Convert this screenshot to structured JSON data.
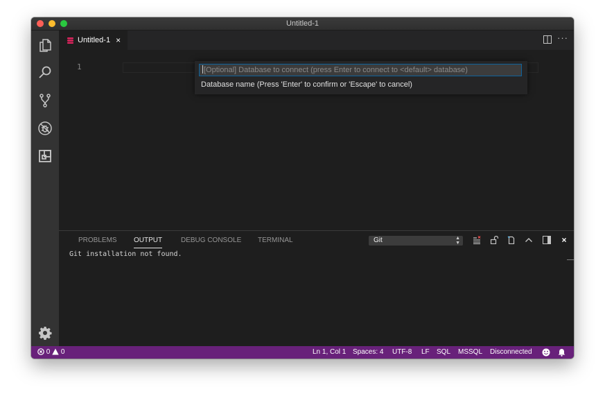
{
  "window": {
    "title": "Untitled-1"
  },
  "tab": {
    "label": "Untitled-1",
    "close_glyph": "×"
  },
  "editor": {
    "line_number": "1"
  },
  "quick_pick": {
    "placeholder": "[Optional] Database to connect (press Enter to connect to <default> database)",
    "message": "Database name (Press 'Enter' to confirm or 'Escape' to cancel)"
  },
  "panel": {
    "tabs": [
      {
        "label": "PROBLEMS"
      },
      {
        "label": "OUTPUT"
      },
      {
        "label": "DEBUG CONSOLE"
      },
      {
        "label": "TERMINAL"
      }
    ],
    "active_tab": "OUTPUT",
    "channel": "Git",
    "output_text": "Git installation not found.",
    "close_glyph": "×"
  },
  "status_bar": {
    "errors": "0",
    "warnings": "0",
    "position": "Ln 1, Col 1",
    "spaces": "Spaces: 4",
    "encoding": "UTF-8",
    "eol": "LF",
    "language": "SQL",
    "provider": "MSSQL",
    "connection": "Disconnected"
  },
  "icons": {
    "activity_bar": [
      "explorer-icon",
      "search-icon",
      "source-control-icon",
      "debug-icon",
      "extensions-icon",
      "gear-icon"
    ],
    "tab": [
      "database-icon",
      "close-icon"
    ],
    "editor_actions": [
      "split-editor-icon",
      "more-icon"
    ],
    "panel_actions": [
      "clear-output-icon",
      "lock-icon",
      "open-log-icon",
      "chevron-up-icon",
      "toggle-panel-icon",
      "close-icon"
    ],
    "status": [
      "error-icon",
      "warning-icon",
      "smiley-icon",
      "bell-icon"
    ]
  },
  "colors": {
    "status_bar": "#68217a",
    "editor_bg": "#1e1e1e",
    "activity_bar": "#333333",
    "focus_border": "#0e639c",
    "tab_db_icon": "#e0245e"
  }
}
